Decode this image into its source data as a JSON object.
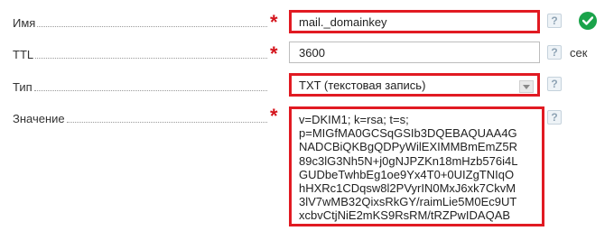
{
  "form": {
    "name": {
      "label": "Имя",
      "value": "mail._domainkey",
      "required_mark": "*",
      "help": "?"
    },
    "ttl": {
      "label": "TTL",
      "value": "3600",
      "unit": "сек",
      "required_mark": "*",
      "help": "?"
    },
    "type": {
      "label": "Тип",
      "selected": "TXT (текстовая запись)",
      "help": "?"
    },
    "value": {
      "label": "Значение",
      "required_mark": "*",
      "help": "?",
      "lines": [
        "v=DKIM1; k=rsa; t=s;",
        "p=MIGfMA0GCSqGSIb3DQEBAQUAA4G",
        "NADCBiQKBgQDPyWilEXIMMBmEmZ5R",
        "89c3lG3Nh5N+j0gNJPZKn18mHzb576i4L",
        "GUDbeTwhbEg1oe9Yx4T0+0UIZgTNIqO",
        "hHXRc1CDqsw8l2PVyrIN0MxJ6xk7CkvM",
        "3lV7wMB32QixsRkGY/raimLie5M0Ec9UT",
        "xcbvCtjNiE2mKS9RsRM/tRZPwIDAQAB"
      ]
    }
  },
  "colors": {
    "highlight": "#e11a22",
    "required": "#d4141c",
    "ok": "#1aa34a"
  }
}
